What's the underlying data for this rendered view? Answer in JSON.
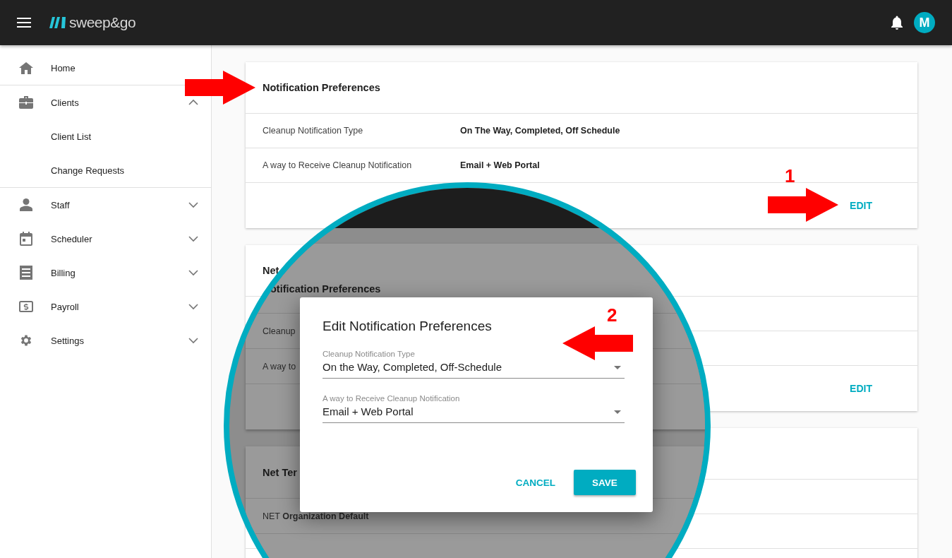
{
  "app_bar": {
    "logo_text": "sweep&go",
    "avatar_initial": "M"
  },
  "sidebar": {
    "items": [
      {
        "label": "Home",
        "kind": "link"
      },
      {
        "label": "Clients",
        "kind": "group",
        "expanded": true,
        "children": [
          {
            "label": "Client List"
          },
          {
            "label": "Change Requests"
          }
        ]
      },
      {
        "label": "Staff",
        "kind": "group",
        "expanded": false
      },
      {
        "label": "Scheduler",
        "kind": "group",
        "expanded": false
      },
      {
        "label": "Billing",
        "kind": "group",
        "expanded": false
      },
      {
        "label": "Payroll",
        "kind": "group",
        "expanded": false
      },
      {
        "label": "Settings",
        "kind": "group",
        "expanded": false
      }
    ]
  },
  "cards": [
    {
      "title": "Notification Preferences",
      "rows": [
        {
          "label": "Cleanup Notification Type",
          "value": "On The Way, Completed, Off Schedule"
        },
        {
          "label": "A way to Receive Cleanup Notification",
          "value": "Email + Web Portal"
        }
      ],
      "action": "EDIT"
    },
    {
      "title": "Net",
      "action": "EDIT"
    }
  ],
  "magnifier": {
    "cards": [
      {
        "title": "otification Preferences",
        "rows": [
          {
            "label": "Cleanup"
          },
          {
            "label": "A way to"
          }
        ]
      },
      {
        "title": "Net Ter",
        "rows": [
          {
            "label": "NET **Organization Default**"
          }
        ]
      }
    ],
    "dialog": {
      "title": "Edit Notification Preferences",
      "fields": [
        {
          "label": "Cleanup Notification Type",
          "value": "On the Way, Completed, Off-Schedule"
        },
        {
          "label": "A way to Receive Cleanup Notification",
          "value": "Email + Web Portal"
        }
      ],
      "buttons": [
        {
          "label": "CANCEL",
          "kind": "text"
        },
        {
          "label": "SAVE",
          "kind": "raised"
        }
      ]
    }
  },
  "annotations": [
    {
      "kind": "arrow-right"
    },
    {
      "kind": "arrow-right",
      "label": "1"
    },
    {
      "kind": "arrow-left",
      "label": "2"
    }
  ]
}
